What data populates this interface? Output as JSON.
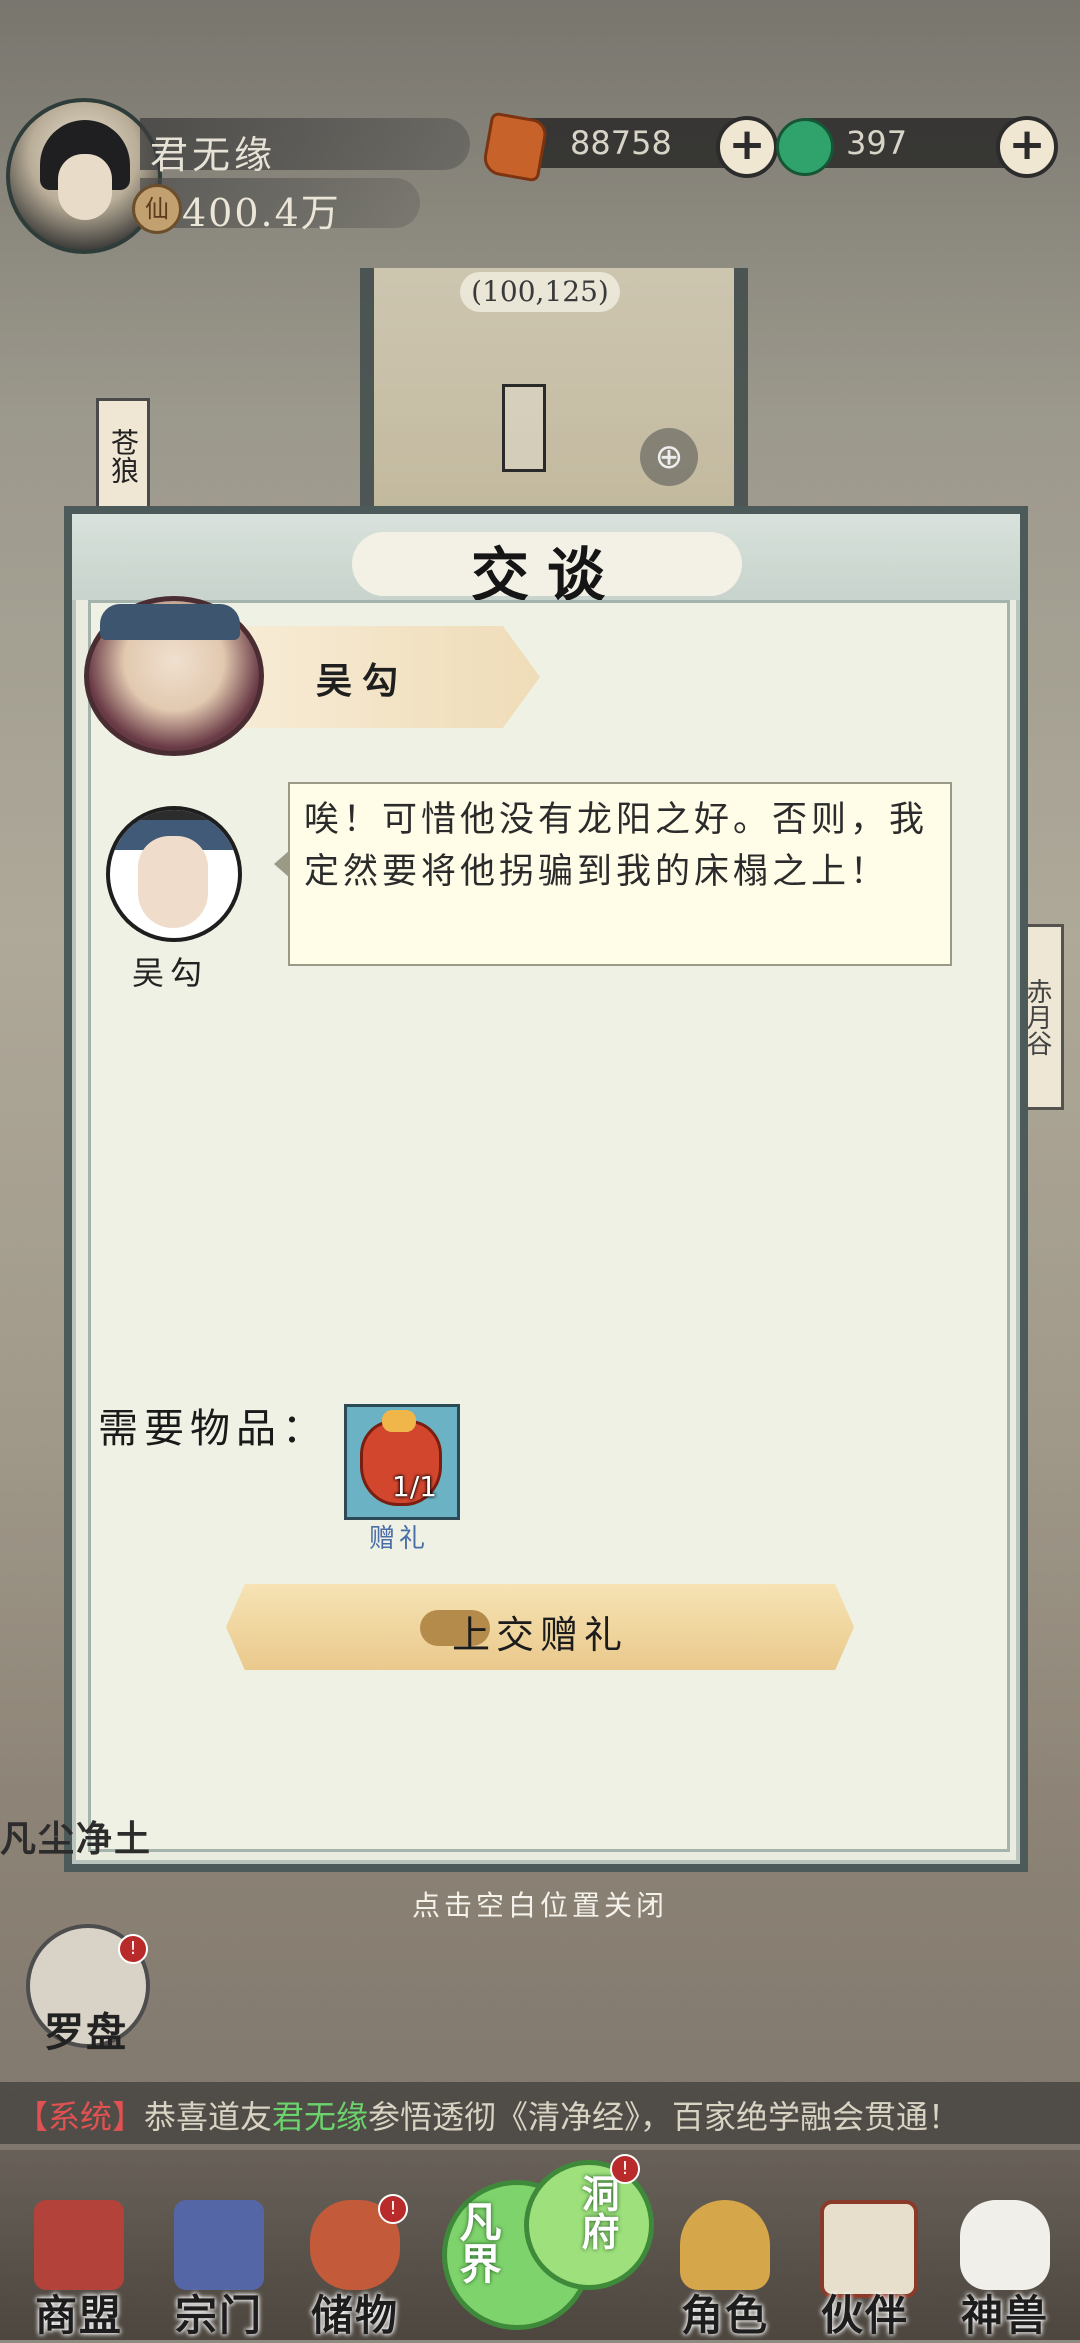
{
  "player": {
    "name": "君无缘",
    "power_icon": "仙",
    "power": "400.4万",
    "avatar_icon": "player-avatar-icon"
  },
  "resources": {
    "gem": {
      "icon": "red-gem-icon",
      "value": "88758"
    },
    "jade": {
      "icon": "green-jade-icon",
      "value": "397"
    },
    "plus": "+"
  },
  "map": {
    "coordinates": "(100,125)",
    "zoom_icon": "⊕",
    "side_sign": "苍狼",
    "right_sign": "赤月谷"
  },
  "dialog": {
    "title": "交谈",
    "speaker_name": "吴勾",
    "message": {
      "sender": "吴勾",
      "text": "唉！可惜他没有龙阳之好。否则，我定然要将他拐骗到我的床榻之上！"
    },
    "requirement": {
      "label": "需要物品：",
      "item_name": "赠礼",
      "item_count": "1/1"
    },
    "submit_label": "上交赠礼",
    "close_hint": "点击空白位置关闭"
  },
  "side": {
    "compass_label": "罗盘",
    "left_label": "凡尘净土"
  },
  "system_message": {
    "tag": "【系统】",
    "prefix": "恭喜道友",
    "name": "君无缘",
    "suffix": "参悟透彻《清净经》，百家绝学融会贯通！"
  },
  "bottom_nav": {
    "items": [
      {
        "label": "商盟",
        "icon": "merchant-hall-icon"
      },
      {
        "label": "宗门",
        "icon": "sect-banner-icon"
      },
      {
        "label": "储物",
        "icon": "storage-bag-icon"
      },
      {
        "label": "角色",
        "icon": "character-hat-icon"
      },
      {
        "label": "伙伴",
        "icon": "partner-scroll-icon"
      },
      {
        "label": "神兽",
        "icon": "divine-beast-icon"
      }
    ],
    "center": {
      "label1": "凡界",
      "label2": "洞府"
    },
    "badge": "!"
  },
  "colors": {
    "dialog_bg": "#eef1e3",
    "accent_red": "#e05252",
    "accent_green": "#6bd36b",
    "button_gold": "#eac98c"
  }
}
